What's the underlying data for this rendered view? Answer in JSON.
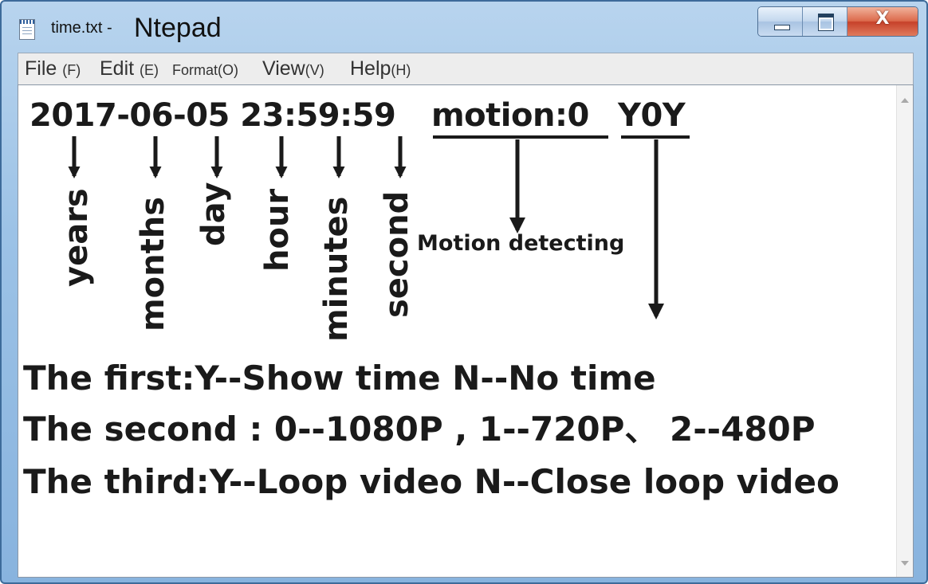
{
  "window": {
    "file_name": "time.txt -",
    "app_name": "Ntepad",
    "controls": {
      "minimize": "minimize",
      "maximize": "maximize",
      "close": "X"
    }
  },
  "menu": [
    {
      "label": "File",
      "key": "(F)"
    },
    {
      "label": "Edit",
      "key": "(E)"
    },
    {
      "label": "Format",
      "key": "(O)"
    },
    {
      "label": "View",
      "key": "(V)"
    },
    {
      "label": "Help",
      "key": "(H)"
    }
  ],
  "document": {
    "timestamp": "2017-06-05 23:59:59",
    "motion": "motion:0",
    "flags": "Y0Y",
    "labels": [
      "years",
      "months",
      "day",
      "hour",
      "minutes",
      "second"
    ],
    "motion_label": "Motion detecting",
    "lines": [
      "The first:Y--Show time  N--No time",
      "The second : 0--1080P , 1--720P、 2--480P",
      "The third:Y--Loop video  N--Close loop video"
    ]
  },
  "colors": {
    "title_bar": "#9cc2e6",
    "close_button": "#c6412a",
    "text": "#1a1a1a"
  },
  "icons": [
    "notepad-icon",
    "minimize-icon",
    "maximize-icon",
    "close-icon",
    "scroll-up-arrow-icon",
    "scroll-down-arrow-icon"
  ]
}
